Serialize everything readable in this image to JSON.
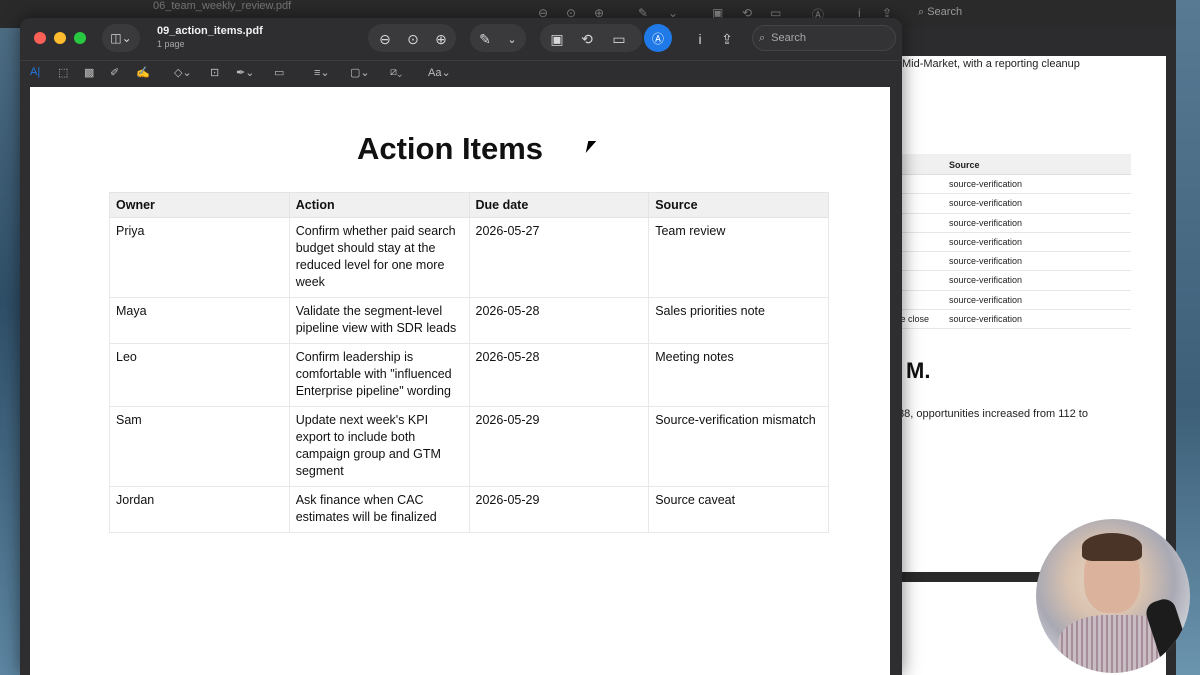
{
  "background_window": {
    "title": "06_team_weekly_review.pdf",
    "search_placeholder": "Search",
    "paragraph_fragment": "Mid-Market, with a reporting cleanup",
    "table_header_source": "Source",
    "rows": [
      {
        "left": "",
        "source": "source-verification"
      },
      {
        "left": "",
        "source": "source-verification"
      },
      {
        "left": "",
        "source": "source-verification"
      },
      {
        "left": "",
        "source": "source-verification"
      },
      {
        "left": "",
        "source": "source-verification"
      },
      {
        "left": "",
        "source": "source-verification"
      },
      {
        "left": "",
        "source": "source-verification"
      },
      {
        "left": "ce close",
        "source": "source-verification"
      }
    ],
    "heading_fragment": "M.",
    "paragraph2_fragment": "88, opportunities increased from 112 to"
  },
  "window": {
    "title": "09_action_items.pdf",
    "subtitle": "1 page",
    "search_placeholder": "Search",
    "traffic_lights": {
      "close": "#fe5f57",
      "minimize": "#febc2e",
      "zoom": "#28c840"
    },
    "accent": "#1f7ae8"
  },
  "document": {
    "title": "Action Items",
    "columns": [
      "Owner",
      "Action",
      "Due date",
      "Source"
    ],
    "rows": [
      {
        "owner": "Priya",
        "action": "Confirm whether paid search budget should stay at the reduced level for one more week",
        "due": "2026-05-27",
        "source": "Team review"
      },
      {
        "owner": "Maya",
        "action": "Validate the segment-level pipeline view with SDR leads",
        "due": "2026-05-28",
        "source": "Sales priorities note"
      },
      {
        "owner": "Leo",
        "action": "Confirm leadership is comfortable with \"influenced Enterprise pipeline\" wording",
        "due": "2026-05-28",
        "source": "Meeting notes"
      },
      {
        "owner": "Sam",
        "action": "Update next week's KPI export to include both campaign group and GTM segment",
        "due": "2026-05-29",
        "source": "Source-verification mismatch"
      },
      {
        "owner": "Jordan",
        "action": "Ask finance when CAC estimates will be finalized",
        "due": "2026-05-29",
        "source": "Source caveat"
      }
    ]
  }
}
